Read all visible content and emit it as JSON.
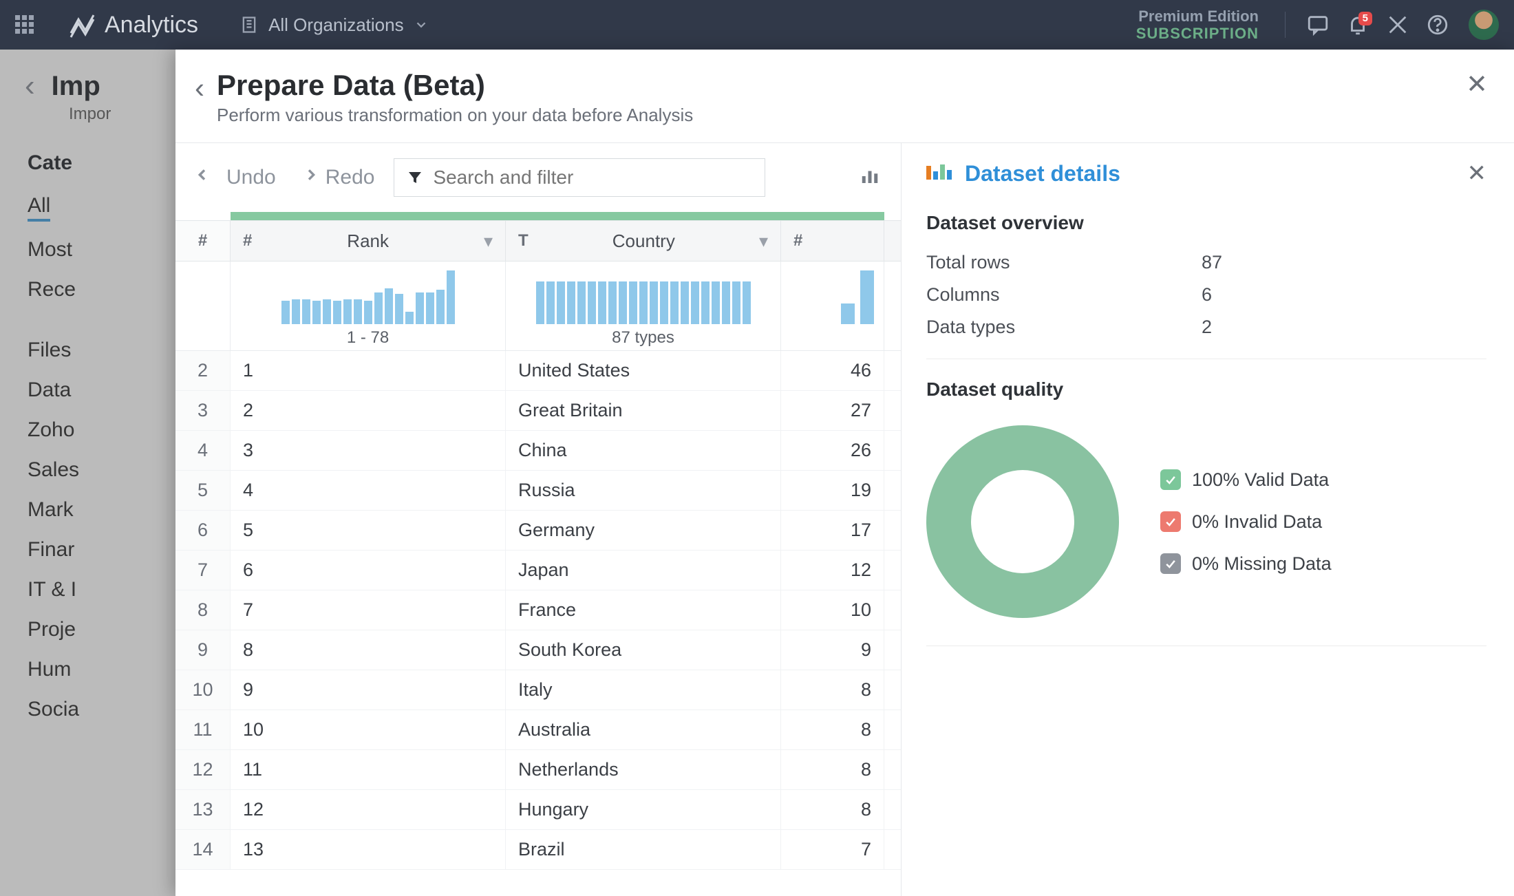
{
  "nav": {
    "brand": "Analytics",
    "org_label": "All Organizations",
    "premium_line1": "Premium Edition",
    "premium_line2": "SUBSCRIPTION",
    "notif_count": "5"
  },
  "bg": {
    "title": "Imp",
    "subtitle": "Impor",
    "category_heading": "Cate",
    "items": [
      "All",
      "Most",
      "Rece"
    ],
    "items2": [
      "Files",
      "Data",
      "Zoho",
      "Sales",
      "Mark",
      "Finar",
      "IT & I",
      "Proje",
      "Hum",
      "Socia"
    ]
  },
  "panel": {
    "title": "Prepare Data (Beta)",
    "subtitle": "Perform various transformation on your data before Analysis",
    "undo": "Undo",
    "redo": "Redo",
    "search_placeholder": "Search and filter"
  },
  "columns": {
    "rank_summary": "1 - 78",
    "country_summary": "87 types",
    "headers": {
      "rank": "Rank",
      "country": "Country"
    }
  },
  "rows": [
    {
      "i": "2",
      "rank": "1",
      "country": "United States",
      "v": "46"
    },
    {
      "i": "3",
      "rank": "2",
      "country": "Great Britain",
      "v": "27"
    },
    {
      "i": "4",
      "rank": "3",
      "country": "China",
      "v": "26"
    },
    {
      "i": "5",
      "rank": "4",
      "country": "Russia",
      "v": "19"
    },
    {
      "i": "6",
      "rank": "5",
      "country": "Germany",
      "v": "17"
    },
    {
      "i": "7",
      "rank": "6",
      "country": "Japan",
      "v": "12"
    },
    {
      "i": "8",
      "rank": "7",
      "country": "France",
      "v": "10"
    },
    {
      "i": "9",
      "rank": "8",
      "country": "South Korea",
      "v": "9"
    },
    {
      "i": "10",
      "rank": "9",
      "country": "Italy",
      "v": "8"
    },
    {
      "i": "11",
      "rank": "10",
      "country": "Australia",
      "v": "8"
    },
    {
      "i": "12",
      "rank": "11",
      "country": "Netherlands",
      "v": "8"
    },
    {
      "i": "13",
      "rank": "12",
      "country": "Hungary",
      "v": "8"
    },
    {
      "i": "14",
      "rank": "13",
      "country": "Brazil",
      "v": "7"
    }
  ],
  "rank_bars": [
    34,
    36,
    36,
    34,
    36,
    34,
    36,
    36,
    34,
    46,
    52,
    44,
    18,
    46,
    46,
    50,
    78
  ],
  "country_bars": [
    62,
    62,
    62,
    62,
    62,
    62,
    62,
    62,
    62,
    62,
    62,
    62,
    62,
    62,
    62,
    62,
    62,
    62,
    62,
    62,
    62
  ],
  "val_bars": [
    30,
    78
  ],
  "details": {
    "title": "Dataset details",
    "overview_heading": "Dataset overview",
    "total_rows_label": "Total rows",
    "total_rows": "87",
    "columns_label": "Columns",
    "columns": "6",
    "dtypes_label": "Data types",
    "dtypes": "2",
    "quality_heading": "Dataset quality",
    "valid": "100% Valid Data",
    "invalid": "0% Invalid Data",
    "missing": "0% Missing Data"
  },
  "chart_data": {
    "type": "bar",
    "title": "",
    "categories": [
      "United States",
      "Great Britain",
      "China",
      "Russia",
      "Germany",
      "Japan",
      "France",
      "South Korea",
      "Italy",
      "Australia",
      "Netherlands",
      "Hungary",
      "Brazil"
    ],
    "values": [
      46,
      27,
      26,
      19,
      17,
      12,
      10,
      9,
      8,
      8,
      8,
      8,
      7
    ],
    "xlabel": "Country",
    "ylabel": "",
    "ylim": [
      0,
      50
    ]
  }
}
